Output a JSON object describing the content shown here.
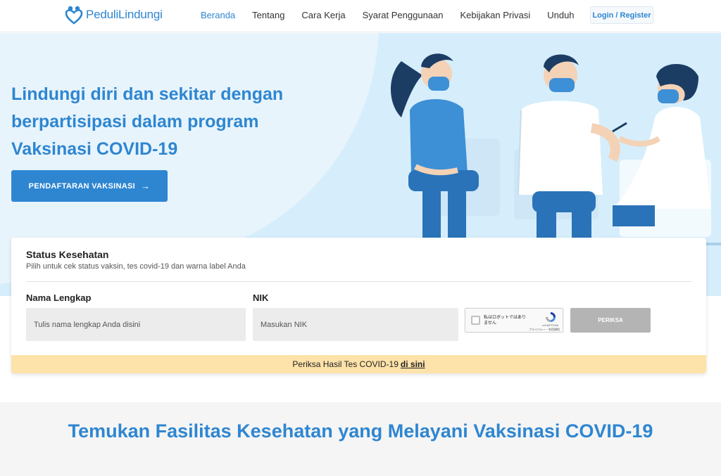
{
  "brand": {
    "name": "PeduliLindungi",
    "color": "#2e86d1"
  },
  "nav": {
    "links": [
      {
        "label": "Beranda",
        "active": true
      },
      {
        "label": "Tentang"
      },
      {
        "label": "Cara Kerja"
      },
      {
        "label": "Syarat Penggunaan"
      },
      {
        "label": "Kebijakan Privasi"
      },
      {
        "label": "Unduh"
      }
    ],
    "login_label": "Login / Register"
  },
  "hero": {
    "title": "Lindungi diri dan sekitar dengan berpartisipasi dalam program Vaksinasi COVID-19",
    "cta_label": "PENDAFTARAN VAKSINASI",
    "cta_icon": "arrow-right-icon",
    "background_color": "#d6eefb"
  },
  "status_card": {
    "title": "Status Kesehatan",
    "subtitle": "Pilih untuk cek status vaksin, tes covid-19 dan warna label Anda",
    "name_field": {
      "label": "Nama Lengkap",
      "placeholder": "Tulis nama lengkap Anda disini"
    },
    "nik_field": {
      "label": "NIK",
      "placeholder": "Masukan NIK"
    },
    "recaptcha": {
      "checkbox_text": "私はロボットではありません",
      "brand": "reCAPTCHA",
      "links": "プライバシー・利用規約"
    },
    "submit_label": "PERIKSA",
    "footer_text": "Periksa Hasil Tes COVID-19",
    "footer_link": "di sini",
    "footer_color": "#fde2a9"
  },
  "bottom": {
    "title": "Temukan Fasilitas Kesehatan yang Melayani Vaksinasi COVID-19"
  }
}
